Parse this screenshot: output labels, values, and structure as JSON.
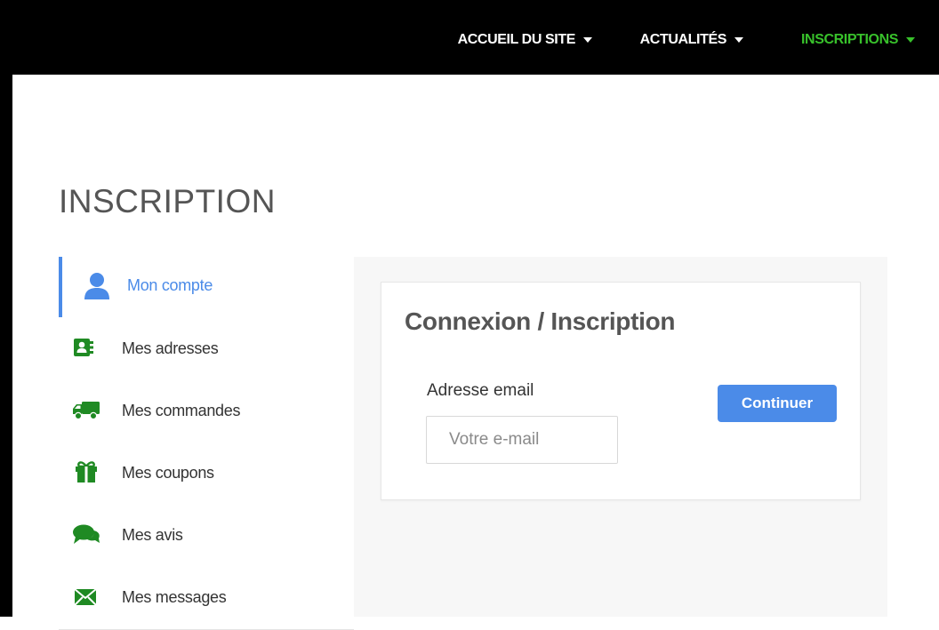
{
  "nav": {
    "items": [
      {
        "label": "ACCUEIL DU SITE",
        "active": false
      },
      {
        "label": "ACTUALITÉS",
        "active": false
      },
      {
        "label": "INSCRIPTIONS",
        "active": true
      }
    ]
  },
  "page": {
    "title": "INSCRIPTION"
  },
  "sidebar": {
    "items": [
      {
        "label": "Mon compte",
        "icon": "user-icon",
        "active": true
      },
      {
        "label": "Mes adresses",
        "icon": "address-book-icon"
      },
      {
        "label": "Mes commandes",
        "icon": "truck-icon"
      },
      {
        "label": "Mes coupons",
        "icon": "gift-icon"
      },
      {
        "label": "Mes avis",
        "icon": "comments-icon"
      },
      {
        "label": "Mes messages",
        "icon": "envelope-icon"
      }
    ]
  },
  "login": {
    "title": "Connexion / Inscription",
    "email_label": "Adresse email",
    "email_placeholder": "Votre e-mail",
    "email_value": "",
    "continue_label": "Continuer"
  },
  "colors": {
    "accent": "#4b8be8",
    "nav_active": "#38c12b",
    "icon_green": "#1f8a23",
    "topbar": "#000000"
  }
}
